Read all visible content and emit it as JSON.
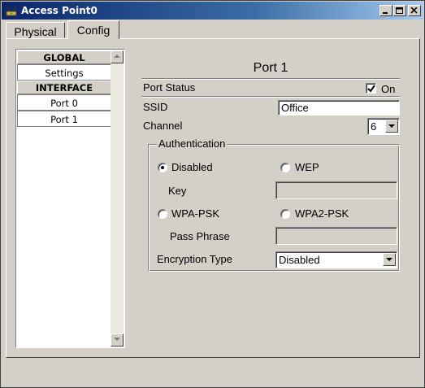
{
  "window": {
    "title": "Access Point0"
  },
  "tabs": [
    {
      "label": "Physical"
    },
    {
      "label": "Config"
    }
  ],
  "sidebar": {
    "global_header": "GLOBAL",
    "settings_item": "Settings",
    "interface_header": "INTERFACE",
    "port0_item": "Port 0",
    "port1_item": "Port 1"
  },
  "port": {
    "title": "Port 1",
    "status_label": "Port Status",
    "on_label": "On",
    "ssid_label": "SSID",
    "ssid_value": "Office",
    "channel_label": "Channel",
    "channel_value": "6"
  },
  "auth": {
    "legend": "Authentication",
    "disabled_label": "Disabled",
    "wep_label": "WEP",
    "key_label": "Key",
    "wpa_psk_label": "WPA-PSK",
    "wpa2_psk_label": "WPA2-PSK",
    "pass_phrase_label": "Pass Phrase",
    "encryption_type_label": "Encryption Type",
    "encryption_value": "Disabled",
    "selected": "Disabled"
  },
  "colors": {
    "face": "#d4d0c8",
    "title_start": "#0a246a",
    "title_end": "#a6caf0"
  }
}
